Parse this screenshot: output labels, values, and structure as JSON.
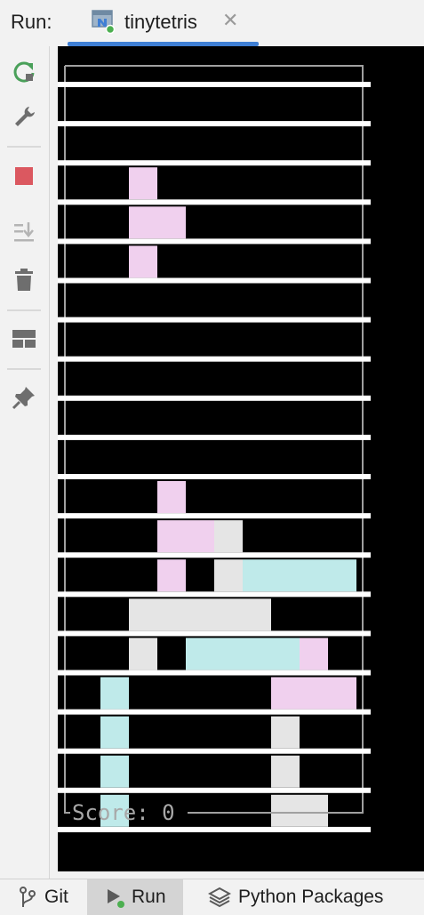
{
  "header": {
    "run_label": "Run:",
    "tab_title": "tinytetris",
    "close_glyph": "✕"
  },
  "toolbar": {
    "icons": [
      "rerun-icon",
      "wrench-icon",
      "stop-icon",
      "scroll-to-end-icon",
      "trash-icon",
      "layout-icon",
      "pin-icon"
    ]
  },
  "console": {
    "score_text": "Score: 0",
    "colors": {
      "pink": "#f0d0ee",
      "gray": "#e5e5e5",
      "cyan": "#bfeaea",
      "background": "#000000",
      "border": "#a0a0a0",
      "line": "#ffffff"
    },
    "grid_rows": [
      ".........",
      ".........",
      "..P......",
      "..PP.....",
      "..P......",
      ".........",
      ".........",
      ".........",
      ".........",
      ".........",
      "...P.....",
      "...PPG...",
      "...P.GCCCC",
      "..GGGGG..",
      "..G.CCCCP.",
      ".C.....PPP",
      ".C.....G..",
      ".C.....G..",
      ".C.....GG."
    ]
  },
  "statusbar": {
    "git_label": "Git",
    "run_label": "Run",
    "python_packages_label": "Python Packages"
  }
}
